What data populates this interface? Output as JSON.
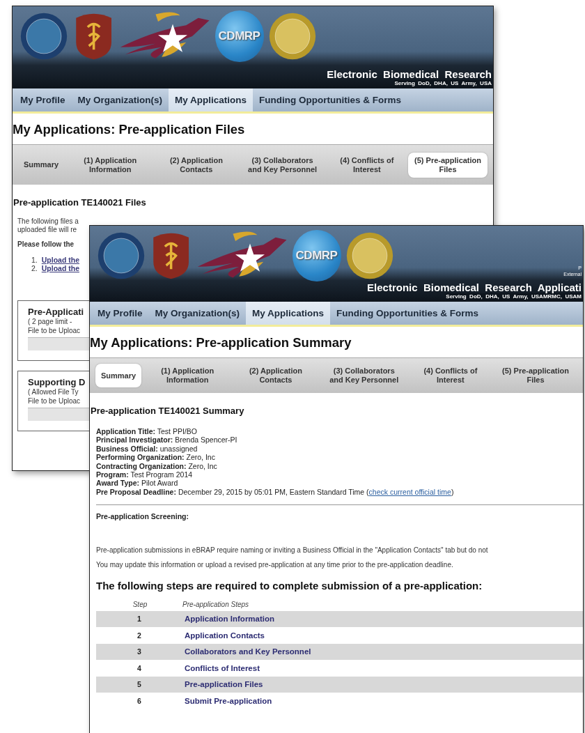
{
  "back_window": {
    "header": {
      "logo_text": "CDMRP",
      "title": "Electronic  Biomedical  Research",
      "subtitle": "Serving  DoD,  DHA,  US  Army,  USA"
    },
    "nav": [
      {
        "label": "My Profile",
        "selected": false
      },
      {
        "label": "My Organization(s)",
        "selected": false
      },
      {
        "label": "My Applications",
        "selected": true
      },
      {
        "label": "Funding Opportunities & Forms",
        "selected": false
      }
    ],
    "page_title": "My Applications: Pre-application Files",
    "tabs": [
      {
        "label": "Summary",
        "selected": false
      },
      {
        "label": "(1) Application Information",
        "selected": false
      },
      {
        "label": "(2) Application Contacts",
        "selected": false
      },
      {
        "label": "(3) Collaborators and Key Personnel",
        "selected": false
      },
      {
        "label": "(4) Conflicts of Interest",
        "selected": false
      },
      {
        "label": "(5) Pre-application Files",
        "selected": true
      }
    ],
    "heading": "Pre-application TE140021 Files",
    "intro_lines": [
      "The following files a",
      "uploaded file will re"
    ],
    "instruction": "Please follow the",
    "links": [
      {
        "number": "1.",
        "label": "Upload the"
      },
      {
        "number": "2.",
        "label": "Upload the"
      }
    ],
    "upload_boxes": [
      {
        "title": "Pre-Applicati",
        "note": "( 2 page limit  -",
        "field_label": "File to be Uploac"
      },
      {
        "title": "Supporting D",
        "note": "( Allowed File Ty",
        "field_label": "File to be Uploac"
      }
    ]
  },
  "front_window": {
    "header": {
      "logo_text": "CDMRP",
      "notes": [
        "P",
        "External"
      ],
      "title": "Electronic  Biomedical  Research  Applicati",
      "subtitle": "Serving  DoD,  DHA,  US  Army,  USAMRMC,  USAM"
    },
    "nav": [
      {
        "label": "My Profile",
        "selected": false
      },
      {
        "label": "My Organization(s)",
        "selected": false
      },
      {
        "label": "My Applications",
        "selected": true
      },
      {
        "label": "Funding Opportunities & Forms",
        "selected": false
      }
    ],
    "page_title": "My Applications: Pre-application Summary",
    "tabs": [
      {
        "label": "Summary",
        "selected": true
      },
      {
        "label": "(1) Application Information",
        "selected": false
      },
      {
        "label": "(2) Application Contacts",
        "selected": false
      },
      {
        "label": "(3) Collaborators and Key Personnel",
        "selected": false
      },
      {
        "label": "(4) Conflicts of Interest",
        "selected": false
      },
      {
        "label": "(5) Pre-application Files",
        "selected": false
      }
    ],
    "heading": "Pre-application TE140021 Summary",
    "details": [
      {
        "label": "Application Title:",
        "value": "Test PPI/BO"
      },
      {
        "label": "Principal Investigator:",
        "value": "Brenda Spencer-PI"
      },
      {
        "label": "Business Official:",
        "value": "unassigned"
      },
      {
        "label": "Performing Organization:",
        "value": "Zero, Inc"
      },
      {
        "label": "Contracting Organization:",
        "value": "Zero, Inc"
      },
      {
        "label": "Program:",
        "value": "Test Program 2014"
      },
      {
        "label": "Award Type:",
        "value": "Pilot Award"
      },
      {
        "label": "Pre Proposal Deadline:",
        "value": "December 29, 2015 by 05:01 PM, Eastern Standard Time (",
        "link": "check current official time",
        "after": ")"
      }
    ],
    "screening_label": "Pre-application Screening:",
    "paragraphs": [
      "Pre-application submissions in eBRAP require naming or inviting a Business Official in the \"Application Contacts\" tab but do not",
      "You may update this information or upload a revised pre-application at any time prior to the pre-application deadline."
    ],
    "steps_heading": "The following steps are required to complete submission of a pre-application:",
    "steps_columns": [
      "Step",
      "Pre-application Steps"
    ],
    "steps": [
      {
        "step": "1",
        "label": "Application Information"
      },
      {
        "step": "2",
        "label": "Application Contacts"
      },
      {
        "step": "3",
        "label": "Collaborators and Key Personnel"
      },
      {
        "step": "4",
        "label": "Conflicts of Interest"
      },
      {
        "step": "5",
        "label": "Pre-application Files"
      },
      {
        "step": "6",
        "label": "Submit Pre-application"
      }
    ]
  }
}
